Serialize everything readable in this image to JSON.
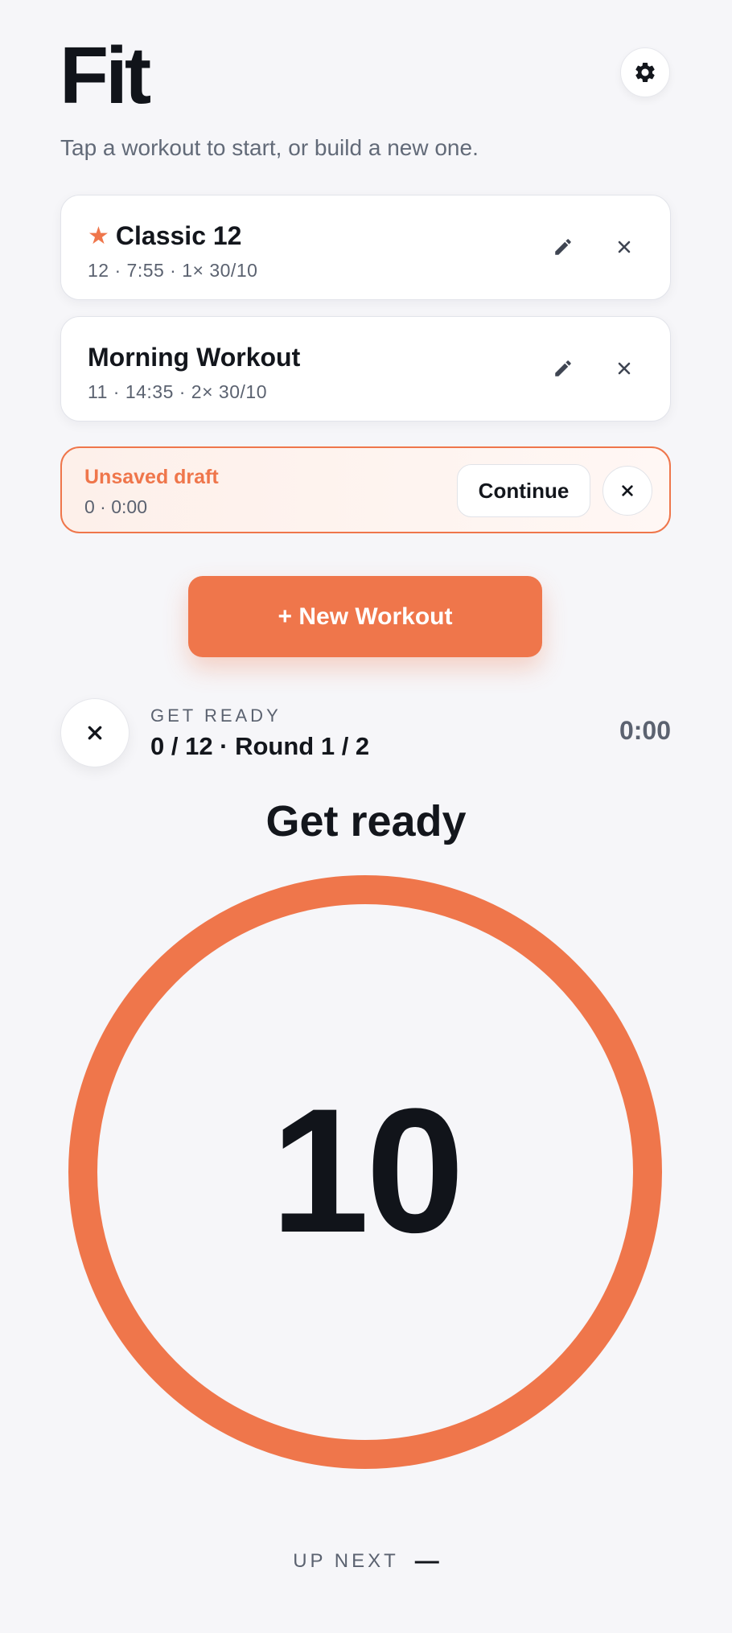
{
  "app": {
    "title": "Fit",
    "subtitle": "Tap a workout to start, or build a new one."
  },
  "workouts": [
    {
      "name": "Classic 12",
      "favorite": true,
      "meta": "12 · 7:55 · 1× 30/10"
    },
    {
      "name": "Morning Workout",
      "favorite": false,
      "meta": "11 · 14:35 · 2× 30/10"
    }
  ],
  "draft": {
    "title": "Unsaved draft",
    "meta": "0 · 0:00",
    "continue_label": "Continue"
  },
  "new_workout_label": "+ New Workout",
  "timer": {
    "phase_label": "GET READY",
    "progress": "0 / 12 · Round 1 / 2",
    "elapsed": "0:00",
    "heading": "Get ready",
    "countdown": "10",
    "up_next_label": "UP NEXT",
    "up_next_value": "—"
  },
  "colors": {
    "accent": "#ef764b",
    "text": "#13161c",
    "muted": "#5b6270",
    "background": "#f6f6f9"
  },
  "icons": {
    "settings": "gear-icon",
    "favorite": "star-icon",
    "edit": "pencil-icon",
    "delete": "close-icon"
  }
}
